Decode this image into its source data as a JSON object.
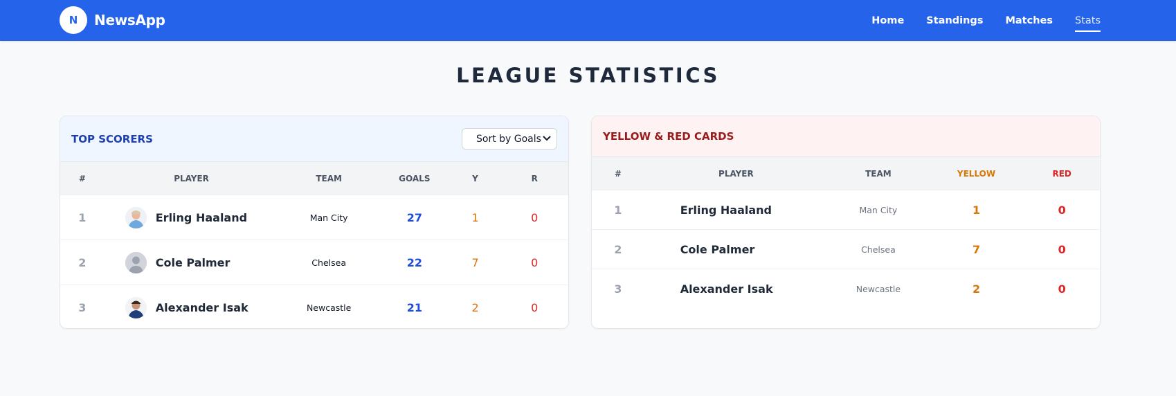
{
  "app": {
    "logo_letter": "N",
    "name": "NewsApp"
  },
  "nav": [
    {
      "label": "Home",
      "active": false
    },
    {
      "label": "Standings",
      "active": false
    },
    {
      "label": "Matches",
      "active": false
    },
    {
      "label": "Stats",
      "active": true
    }
  ],
  "page_title": "LEAGUE STATISTICS",
  "scorers": {
    "title": "TOP SCORERS",
    "sort_select": "Sort by Goals",
    "columns": [
      "#",
      "PLAYER",
      "TEAM",
      "GOALS",
      "Y",
      "R"
    ],
    "rows": [
      {
        "rank": "1",
        "player": "Erling Haaland",
        "team": "Man City",
        "goals": "27",
        "y": "1",
        "r": "0",
        "avatar": "player-photo"
      },
      {
        "rank": "2",
        "player": "Cole Palmer",
        "team": "Chelsea",
        "goals": "22",
        "y": "7",
        "r": "0",
        "avatar": "placeholder-avatar"
      },
      {
        "rank": "3",
        "player": "Alexander Isak",
        "team": "Newcastle",
        "goals": "21",
        "y": "2",
        "r": "0",
        "avatar": "player-photo"
      }
    ]
  },
  "cards": {
    "title": "YELLOW & RED CARDS",
    "columns": [
      "#",
      "PLAYER",
      "TEAM",
      "YELLOW",
      "RED"
    ],
    "rows": [
      {
        "rank": "1",
        "player": "Erling Haaland",
        "team": "Man City",
        "yellow": "1",
        "red": "0"
      },
      {
        "rank": "2",
        "player": "Cole Palmer",
        "team": "Chelsea",
        "yellow": "7",
        "red": "0"
      },
      {
        "rank": "3",
        "player": "Alexander Isak",
        "team": "Newcastle",
        "yellow": "2",
        "red": "0"
      }
    ]
  },
  "colors": {
    "brand": "#2563eb",
    "goals": "#1d4ed8",
    "yellow": "#d97706",
    "red": "#dc2626"
  }
}
